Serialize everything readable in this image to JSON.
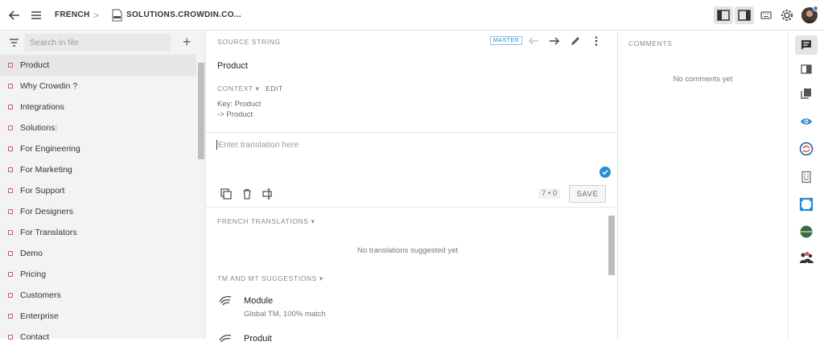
{
  "topbar": {
    "language": "FRENCH",
    "separator": ">",
    "file_name": "SOLUTIONS.CROWDIN.CO..."
  },
  "sidebar": {
    "search_placeholder": "Search in file",
    "add": "+",
    "items": [
      {
        "label": "Product"
      },
      {
        "label": "Why Crowdin ?"
      },
      {
        "label": "Integrations"
      },
      {
        "label": "Solutions:"
      },
      {
        "label": "For Engineering"
      },
      {
        "label": "For Marketing"
      },
      {
        "label": "For Support"
      },
      {
        "label": "For Designers"
      },
      {
        "label": "For Translators"
      },
      {
        "label": "Demo"
      },
      {
        "label": "Pricing"
      },
      {
        "label": "Customers"
      },
      {
        "label": "Enterprise"
      },
      {
        "label": "Contact"
      }
    ]
  },
  "source": {
    "header": "SOURCE STRING",
    "badge": "MASTER",
    "text": "Product",
    "context_header": "CONTEXT",
    "edit_label": "EDIT",
    "context_lines": [
      "Key: Product",
      "-> Product"
    ]
  },
  "translation": {
    "placeholder": "Enter translation here",
    "count_left": "7",
    "count_sep": "•",
    "count_right": "0",
    "save_label": "SAVE"
  },
  "french_translations": {
    "header": "FRENCH TRANSLATIONS",
    "empty": "No translations suggested yet"
  },
  "tm_mt": {
    "header": "TM AND MT SUGGESTIONS",
    "items": [
      {
        "title": "Module",
        "subtitle": "Global TM, 100% match"
      },
      {
        "title": "Produit",
        "subtitle": ""
      }
    ]
  },
  "comments": {
    "header": "COMMENTS",
    "empty": "No comments yet"
  },
  "colors": {
    "accent": "#2a8fd6",
    "marker": "#d9534f"
  }
}
